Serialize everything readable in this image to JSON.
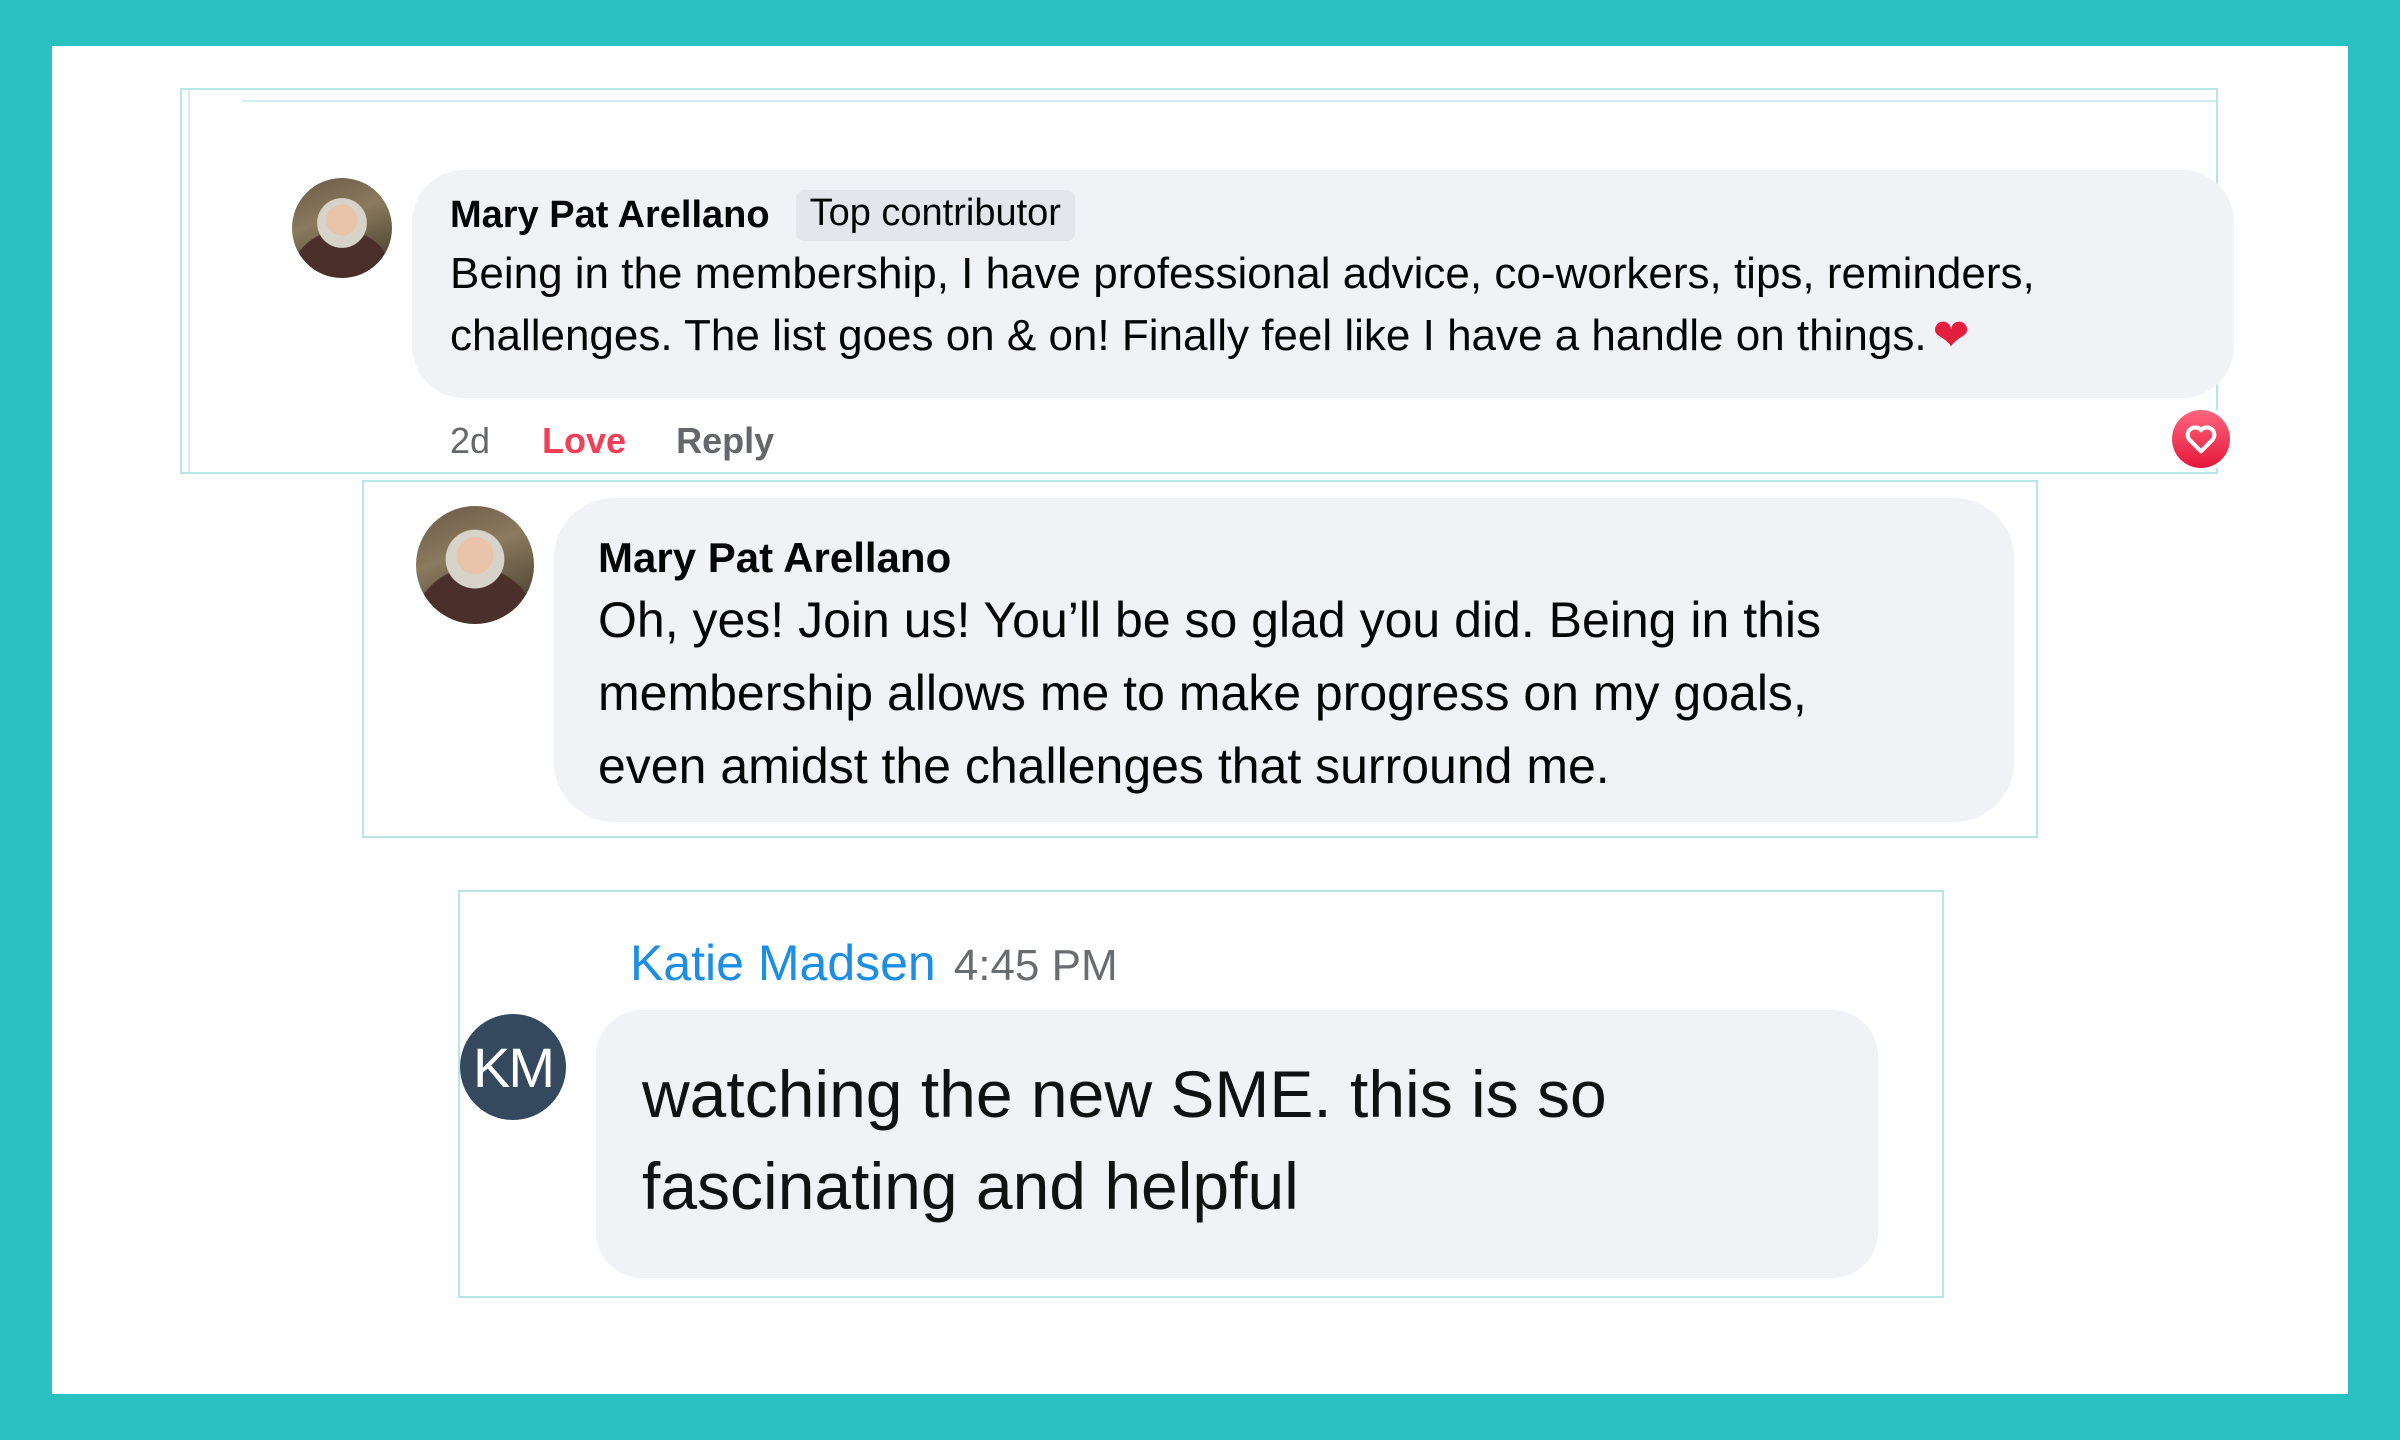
{
  "comments": [
    {
      "author": "Mary Pat Arellano",
      "badge": "Top contributor",
      "text": "Being in the membership, I have professional advice, co-workers, tips, reminders, challenges. The list goes on & on! Finally feel like I have a handle on things.",
      "emoji": "❤",
      "timestamp": "2d",
      "love_label": "Love",
      "reply_label": "Reply",
      "reaction_icon": "heart-reaction-icon"
    },
    {
      "author": "Mary Pat Arellano",
      "text_lines": [
        "Oh, yes! Join us! You’ll be so glad you did. Being in this",
        "membership allows me to make progress on my goals,",
        "even amidst the challenges that surround me."
      ]
    },
    {
      "author": "Katie Madsen",
      "time": "4:45 PM",
      "initials": "KM",
      "text_lines": [
        "watching the new SME. this is so",
        "fascinating and helpful"
      ]
    }
  ],
  "colors": {
    "frame": "#29c0c2",
    "bubble": "#f0f2f5",
    "love": "#f33e58",
    "link_name": "#1d8ee5",
    "km_avatar": "#34495e"
  }
}
